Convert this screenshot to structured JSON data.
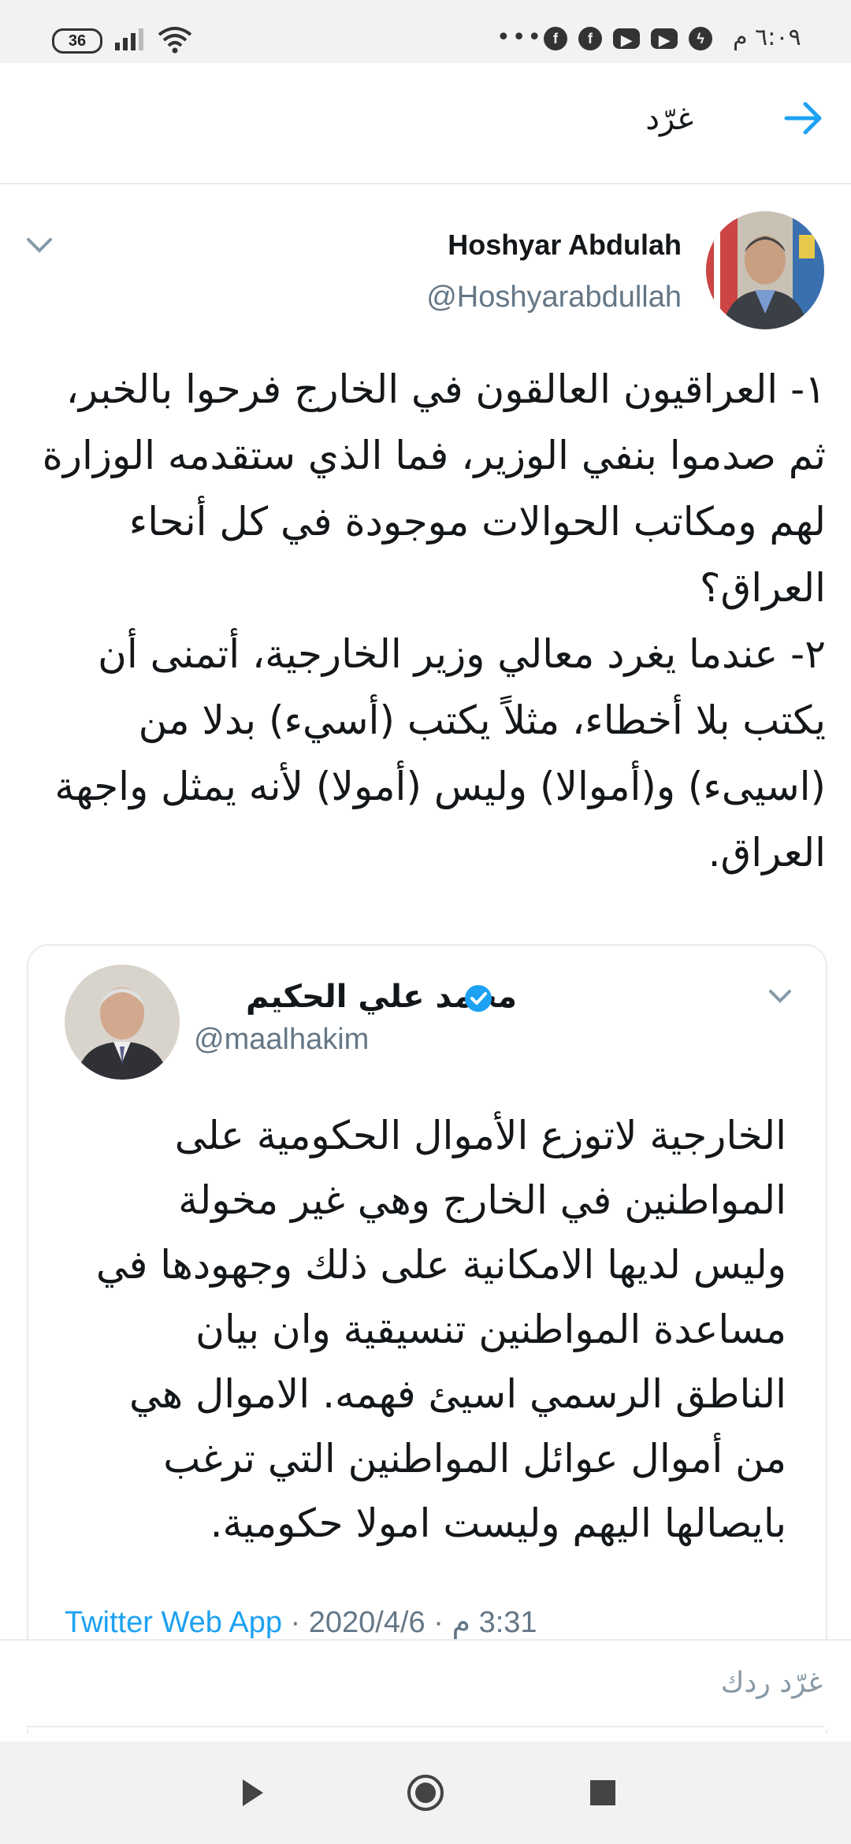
{
  "status_bar": {
    "battery": "36",
    "time": "٦:٠٩ م",
    "more": "•••",
    "notifications": [
      "facebook-icon",
      "facebook-icon",
      "youtube-icon",
      "youtube-icon",
      "messenger-icon"
    ]
  },
  "header": {
    "title": "غرّد",
    "back_icon": "arrow-icon"
  },
  "tweet": {
    "author_name": "Hoshyar Abdulah",
    "author_handle": "@Hoshyarabdullah",
    "paragraph_1": "١- العراقيون العالقون في الخارج فرحوا بالخبر، ثم صدموا بنفي الوزير، فما الذي ستقدمه الوزارة لهم ومكاتب الحوالات موجودة في كل أنحاء العراق؟",
    "paragraph_2": "٢- عندما يغرد معالي وزير الخارجية، أتمنى أن يكتب بلا أخطاء، مثلاً يكتب (أسيء) بدلا من (اسيىء) و(أموالا) وليس (أمولا) لأنه يمثل واجهة العراق."
  },
  "quoted_tweet": {
    "author_name": "محمد علي الحكيم",
    "author_handle": "@maalhakim",
    "text": "الخارجية لاتوزع الأموال الحكومية على المواطنين في الخارج وهي غير مخولة وليس لديها الامكانية على ذلك وجهودها في مساعدة المواطنين تنسيقية وان بيان الناطق الرسمي اسيئ فهمه. الاموال هي من أموال عوائل المواطنين التي ترغب بايصالها اليهم وليست امولا حكومية.",
    "source": "Twitter Web App",
    "separator_1": " · ",
    "date": "2020/4/6",
    "separator_2": " · ",
    "time": "3:31 م"
  },
  "reply": {
    "placeholder": "غرّد ردك"
  },
  "colors": {
    "accent": "#1da1f2",
    "secondary_text": "#657786",
    "divider": "#e6ecf0"
  }
}
